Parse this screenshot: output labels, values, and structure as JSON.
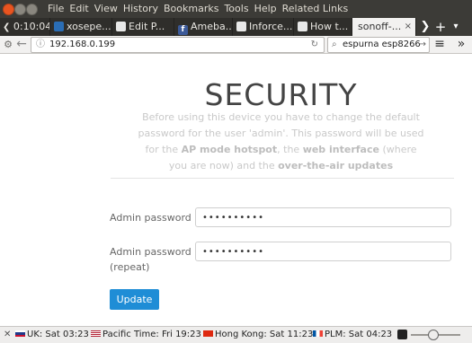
{
  "menu": [
    "File",
    "Edit",
    "View",
    "History",
    "Bookmarks",
    "Tools",
    "Help",
    "Related Links"
  ],
  "tabs": [
    {
      "label": "0:10:04",
      "icon": "back-arrow-icon",
      "color": "#3c3b37"
    },
    {
      "label": "xosepe...",
      "icon": "blue-favicon",
      "color": "#2a6db5"
    },
    {
      "label": "Edit P...",
      "icon": "page-favicon",
      "color": "#e8e8e8"
    },
    {
      "label": "Ameba...",
      "icon": "facebook-favicon",
      "color": "#3b5998"
    },
    {
      "label": "Inforce...",
      "icon": "page-favicon",
      "color": "#e8e8e8"
    },
    {
      "label": "How t...",
      "icon": "page-favicon",
      "color": "#e8e8e8"
    },
    {
      "label": "sonoff-...",
      "icon": "",
      "color": "#f2f1f0"
    }
  ],
  "tab_close_glyph": "×",
  "new_tab_glyph": "+",
  "url": "192.168.0.199",
  "search": "espurna esp8266",
  "page": {
    "title": "SECURITY",
    "intro_1": "Before using this device you have to change the default password for the user 'admin'. This password will be used for the",
    "intro_ap": "AP mode hotspot",
    "intro_2": ", the",
    "intro_web": "web interface",
    "intro_3": "(where you are now) and the",
    "intro_ota": "over-the-air updates",
    "label_password": "Admin password",
    "label_repeat_1": "Admin password",
    "label_repeat_2": "(repeat)",
    "password_mask": "••••••••••",
    "repeat_mask": "••••••••••",
    "update_label": "Update"
  },
  "status": [
    {
      "label": "UK: Sat 03:23",
      "flag_color": "#1f3a8a"
    },
    {
      "label": "Pacific Time: Fri 19:23",
      "flag_color": "#b22234"
    },
    {
      "label": "Hong Kong: Sat 11:23",
      "flag_color": "#de2910"
    },
    {
      "label": "PLM: Sat 04:23",
      "flag_color": "#0055a4"
    }
  ],
  "colors": {
    "accent_button": "#1f8dd6",
    "ubuntu_orange": "#e95420"
  }
}
